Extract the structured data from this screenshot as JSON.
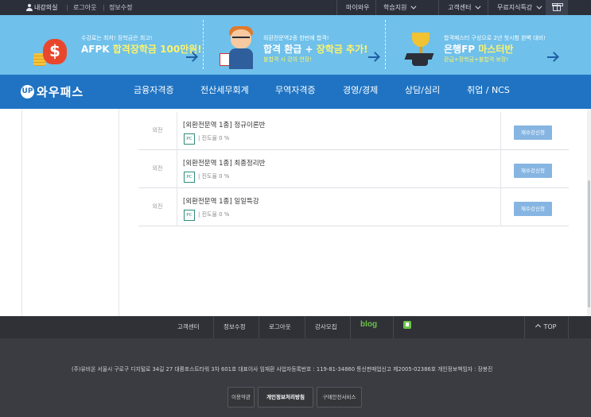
{
  "topbar": {
    "user_label": "내강의실",
    "logout": "로그아웃",
    "info": "정보수정",
    "menus": [
      "마이와우",
      "학습지원",
      "고객센터",
      "무료지식특강"
    ]
  },
  "banner": {
    "promos": [
      {
        "line1": "수강료는 최저! 장학금은 최고!",
        "title_prefix": "AFPK ",
        "title_highlight": "합격장학금 100만원!",
        "line3": ""
      },
      {
        "line1": "외환전문역2종 한번에 합격!",
        "title_prefix": "합격 환급 + ",
        "title_highlight": "장학금 추가!",
        "line3": "불합격 시 강의 연장!"
      },
      {
        "line1": "합격패스터 구성으로 2년 첫시험 완벽 대비!",
        "title_prefix": "은행FP ",
        "title_highlight": "마스터반",
        "line3": "환급+장학금+불합격 보장!"
      }
    ]
  },
  "nav": {
    "logo_mark": "UP",
    "logo_text": "와우패스",
    "items": [
      "금융자격증",
      "전산세무회계",
      "무역자격증",
      "경영/경제",
      "상담/심리",
      "취업 / NCS"
    ]
  },
  "courses": [
    {
      "category": "외전",
      "title": "[외환전문역 1종] 정규이론반",
      "device": "PC",
      "progress": "| 진도율 0 %",
      "button": "재수강신청"
    },
    {
      "category": "외전",
      "title": "[외환전문역 1종] 최종정리반",
      "device": "PC",
      "progress": "| 진도율 0 %",
      "button": "재수강신청"
    },
    {
      "category": "외전",
      "title": "[외환전문역 1종] 일일특강",
      "device": "PC",
      "progress": "| 진도율 0 %",
      "button": "재수강신청"
    }
  ],
  "footer_nav": {
    "links": [
      "고객센터",
      "정보수정",
      "로그아웃",
      "강사모집"
    ],
    "blog": "blog",
    "top": "TOP"
  },
  "footer": {
    "address": "(주)유비온 서울시 구로구 디지털로 34길 27 대륭포스트타워 3차 601호 대표이사 임재환 사업자등록번호 : 119-81-34860 통신판매업신고 제2005-02386호 개인정보책임자 : 장봉진",
    "buttons": [
      "이용약관",
      "개인정보처리방침",
      "구매안전서비스"
    ]
  }
}
